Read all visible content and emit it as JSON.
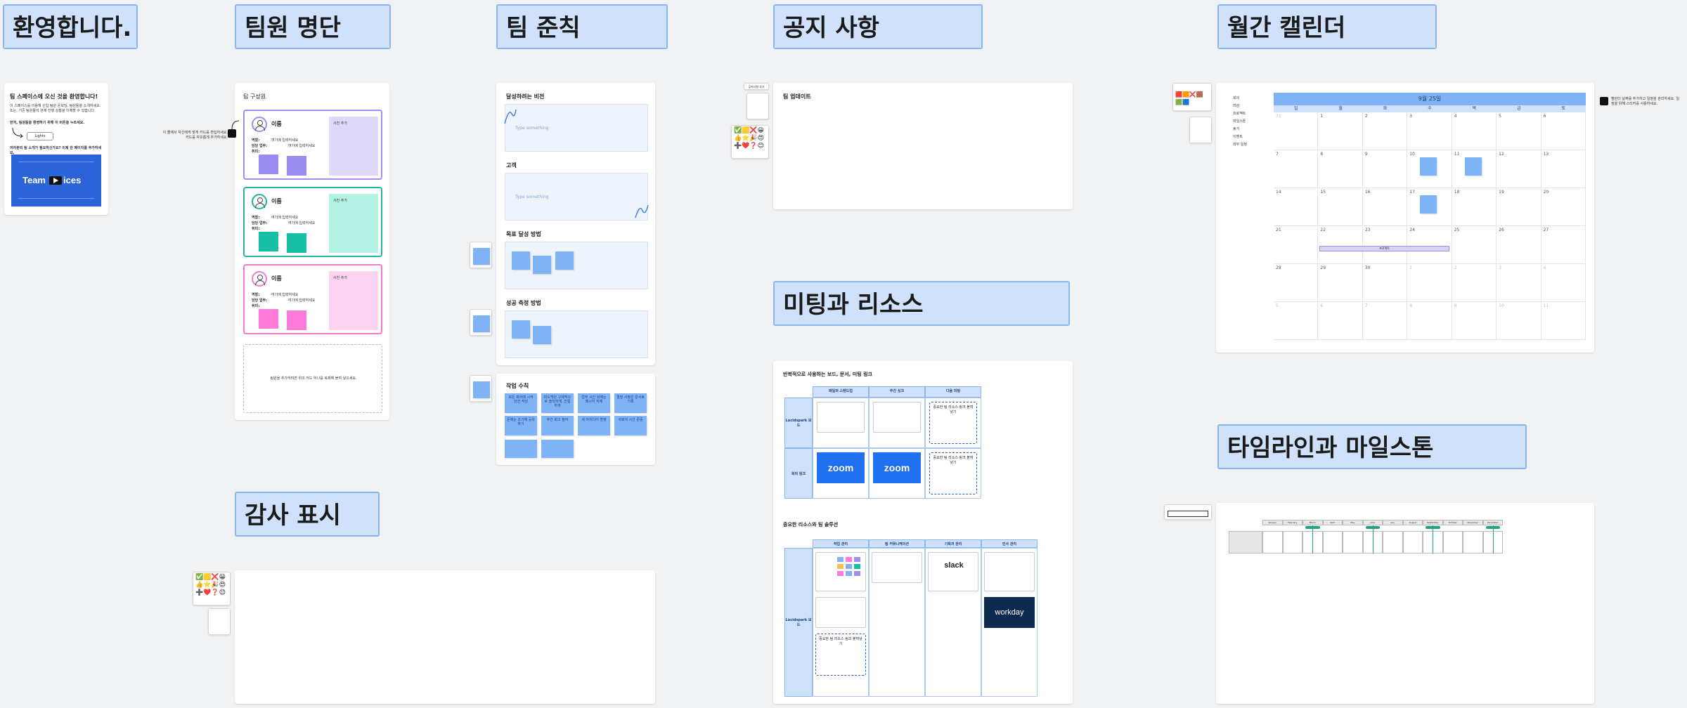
{
  "sections": {
    "welcome": "환영합니다.",
    "roster": "팀원 명단",
    "rules": "팀 준칙",
    "notice": "공지 사항",
    "calendar": "월간 캘린더",
    "meetings": "미팅과 리소스",
    "thanks": "감사 표시",
    "timeline": "타임라인과 마일스톤"
  },
  "welcome": {
    "heading": "팀 스페이스에 오신 것을 환영합니다!",
    "body": "이 스페이스를 이용해 신입 팀원 온보딩, 팀원들을 소개하세요. 또는, 기존 팀원들이 현재 진행 상황을 이해할 수 있습니다.",
    "cta_label": "먼저, 팀원들을 환영하기 위해 이 버튼을 누르세요.",
    "button": "Lights",
    "footer": "여러분의 팀 소개가 필요하신가요? 이제 한 페이지를 추가하세요.",
    "banner_left": "Team",
    "banner_right": "ices",
    "banner_icon": "play-icon"
  },
  "roster": {
    "group_title": "팀 구성원",
    "side_note": "이 줄에서 자신에게 맞게 카드를 편집하세요. 카드를 자유롭게 추가하세요.",
    "members": [
      {
        "name": "이름",
        "role_label": "역할:",
        "role_value": "여기에 입력하세요",
        "dept_label": "담당 업무:",
        "dept_value": "여기에 입력하세요",
        "likes_label": "취미:",
        "photo_label": "사진 추가",
        "color": "#a58cf0",
        "fill": "#ded9fb",
        "sticky": "#9b8cf2"
      },
      {
        "name": "이름",
        "role_label": "역할:",
        "role_value": "여기에 입력하세요",
        "dept_label": "담당 업무:",
        "dept_value": "여기에 입력하세요",
        "likes_label": "취미:",
        "photo_label": "사진 추가",
        "color": "#1fb8a0",
        "fill": "#b3f2e3",
        "sticky": "#17c0a4"
      },
      {
        "name": "이름",
        "role_label": "역할:",
        "role_value": "여기에 입력하세요",
        "dept_label": "담당 업무:",
        "dept_value": "여기에 입력하세요",
        "likes_label": "취미:",
        "photo_label": "사진 추가",
        "color": "#f07ad0",
        "fill": "#fcd3f0",
        "sticky": "#ff7ad9"
      }
    ],
    "add_card": "팀원을 추가하려면 위의 카드 하나를 복제해 붙여 넣으세요."
  },
  "rules": {
    "vision_title": "달성하려는 비전",
    "vision_placeholder": "Type something",
    "customer_title": "고객",
    "customer_placeholder": "Type something",
    "goals_title": "목표 달성 방법",
    "metrics_title": "성공 측정 방법",
    "workrules_title": "작업 수칙",
    "workrules": [
      "모든 회의에 시작 안건 작성",
      "피드백은 구체적으로 솔직하게, 친절하게",
      "업무 시간 외에는 메시지 자제",
      "결정 사항은 문서로 기록",
      "문제는 조기에 공유하기",
      "주간 회고 참여",
      "새 아이디어 환영",
      "서로의 시간 존중"
    ]
  },
  "notice": {
    "title": "팀 업데이트",
    "tag": "공지사항 추가"
  },
  "calendar": {
    "month_title": "9월 25일",
    "weekdays": [
      "일",
      "월",
      "화",
      "수",
      "목",
      "금",
      "토"
    ],
    "legend": [
      "회의",
      "마감",
      "프로젝트",
      "마일스톤",
      "휴가",
      "이벤트",
      "외부 일정"
    ],
    "note": "캘린더 날짜를 추가하고 일정을 관리하세요. 일정을 위해 스티커를 사용하세요.",
    "event_bar": "프로젝트",
    "weeks": [
      [
        "31",
        "1",
        "2",
        "3",
        "4",
        "5",
        "6"
      ],
      [
        "7",
        "8",
        "9",
        "10",
        "11",
        "12",
        "13"
      ],
      [
        "14",
        "15",
        "16",
        "17",
        "18",
        "19",
        "20"
      ],
      [
        "21",
        "22",
        "23",
        "24",
        "25",
        "26",
        "27"
      ],
      [
        "28",
        "29",
        "30",
        "1",
        "2",
        "3",
        "4"
      ],
      [
        "5",
        "6",
        "7",
        "8",
        "9",
        "10",
        "11"
      ]
    ]
  },
  "meetings": {
    "recurring_title": "반복적으로 사용하는 보드, 문서, 미팅 링크",
    "recurring_cols": [
      "매일의 스탠드업",
      "주간 싱크",
      "다음 미팅"
    ],
    "recurring_rows": [
      "Lucidspark 보드",
      "회의 링크"
    ],
    "recurring_note": "중요한 팀 리소스 링크 붙여넣기",
    "resources_title": "중요한 리소스와 팀 솔루션",
    "resources_cols": [
      "작업 관리",
      "팀 커뮤니케이션",
      "기획과 관리",
      "인사 관리"
    ],
    "resources_side": "Lucidspark 보드",
    "zoom_label": "zoom",
    "slack_label": "slack",
    "workday_label": "workday"
  },
  "timeline": {
    "months": [
      "January",
      "February",
      "March",
      "April",
      "May",
      "June",
      "July",
      "August",
      "September",
      "October",
      "November",
      "December"
    ]
  },
  "colors": {
    "accent": "#7fb3f5",
    "title_bg": "#cfe1fb",
    "title_border": "#8ab6f0",
    "canvas": "#f1f2f4"
  }
}
